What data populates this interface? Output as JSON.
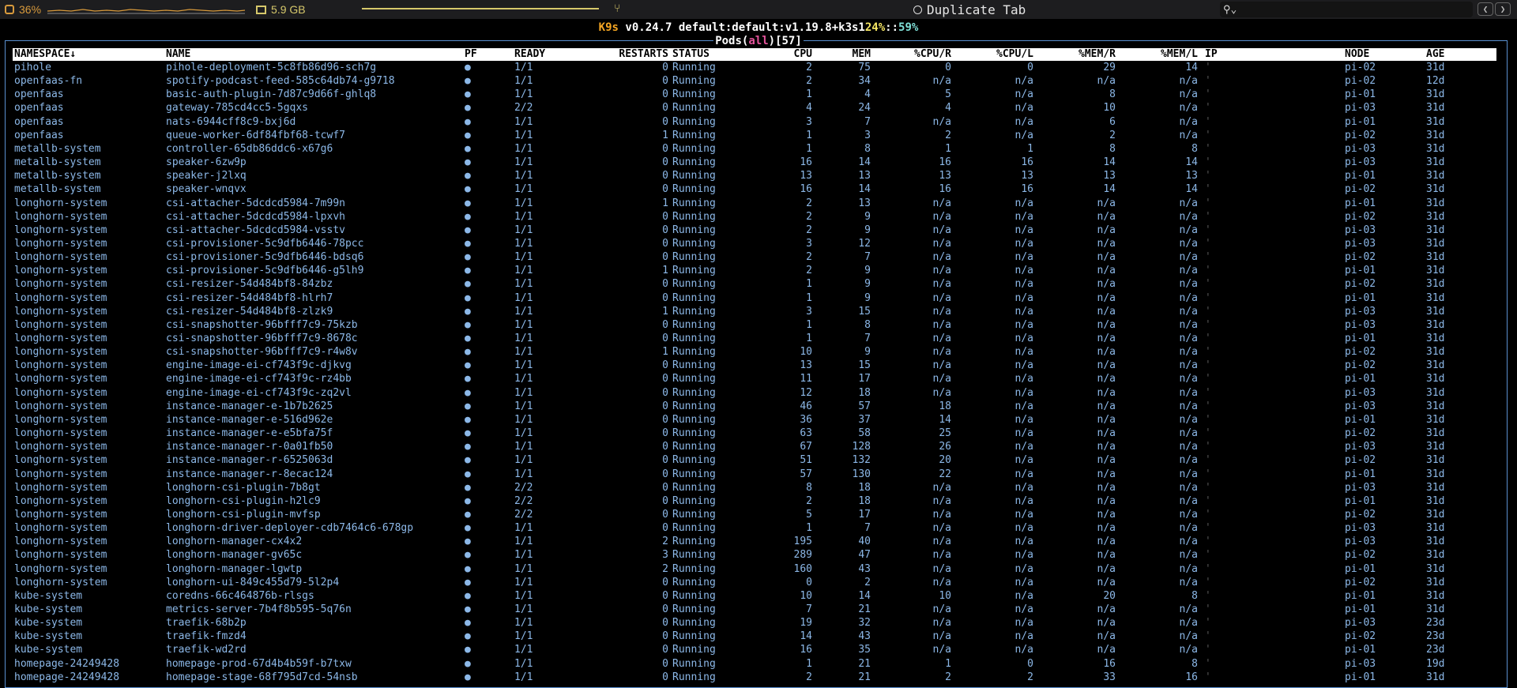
{
  "topbar": {
    "cpu_percent": "36%",
    "memory": "5.9 GB",
    "duplicate_tab": "Duplicate Tab"
  },
  "header": {
    "app": "K9s",
    "version": "v0.24.7",
    "context": "default:default:v1.19.8+k3s1",
    "cpu": "24%",
    "sep": "::",
    "mem": "59%"
  },
  "frame": {
    "resource": "Pods",
    "filter": "all",
    "count": "57"
  },
  "columns": {
    "namespace": "NAMESPACE↓",
    "name": "NAME",
    "pf": "PF",
    "ready": "READY",
    "restarts": "RESTARTS",
    "status": "STATUS",
    "cpu": "CPU",
    "mem": "MEM",
    "cpu_r": "%CPU/R",
    "cpu_l": "%CPU/L",
    "mem_r": "%MEM/R",
    "mem_l": "%MEM/L",
    "ip": "IP",
    "node": "NODE",
    "age": "AGE"
  },
  "rows": [
    [
      "pihole",
      "pihole-deployment-5c8fb86d96-sch7g",
      "●",
      "1/1",
      "0",
      "Running",
      "2",
      "75",
      "0",
      "0",
      "29",
      "14",
      "pi-02",
      "31d"
    ],
    [
      "openfaas-fn",
      "spotify-podcast-feed-585c64db74-g9718",
      "●",
      "1/1",
      "0",
      "Running",
      "2",
      "34",
      "n/a",
      "n/a",
      "n/a",
      "n/a",
      "pi-02",
      "12d"
    ],
    [
      "openfaas",
      "basic-auth-plugin-7d87c9d66f-ghlq8",
      "●",
      "1/1",
      "0",
      "Running",
      "1",
      "4",
      "5",
      "n/a",
      "8",
      "n/a",
      "pi-01",
      "31d"
    ],
    [
      "openfaas",
      "gateway-785cd4cc5-5gqxs",
      "●",
      "2/2",
      "0",
      "Running",
      "4",
      "24",
      "4",
      "n/a",
      "10",
      "n/a",
      "pi-03",
      "31d"
    ],
    [
      "openfaas",
      "nats-6944cff8c9-bxj6d",
      "●",
      "1/1",
      "0",
      "Running",
      "3",
      "7",
      "n/a",
      "n/a",
      "6",
      "n/a",
      "pi-01",
      "31d"
    ],
    [
      "openfaas",
      "queue-worker-6df84fbf68-tcwf7",
      "●",
      "1/1",
      "1",
      "Running",
      "1",
      "3",
      "2",
      "n/a",
      "2",
      "n/a",
      "pi-02",
      "31d"
    ],
    [
      "metallb-system",
      "controller-65db86ddc6-x67g6",
      "●",
      "1/1",
      "0",
      "Running",
      "1",
      "8",
      "1",
      "1",
      "8",
      "8",
      "pi-03",
      "31d"
    ],
    [
      "metallb-system",
      "speaker-6zw9p",
      "●",
      "1/1",
      "0",
      "Running",
      "16",
      "14",
      "16",
      "16",
      "14",
      "14",
      "pi-03",
      "31d"
    ],
    [
      "metallb-system",
      "speaker-j2lxq",
      "●",
      "1/1",
      "0",
      "Running",
      "13",
      "13",
      "13",
      "13",
      "13",
      "13",
      "pi-01",
      "31d"
    ],
    [
      "metallb-system",
      "speaker-wnqvx",
      "●",
      "1/1",
      "0",
      "Running",
      "16",
      "14",
      "16",
      "16",
      "14",
      "14",
      "pi-02",
      "31d"
    ],
    [
      "longhorn-system",
      "csi-attacher-5dcdcd5984-7m99n",
      "●",
      "1/1",
      "1",
      "Running",
      "2",
      "13",
      "n/a",
      "n/a",
      "n/a",
      "n/a",
      "pi-01",
      "31d"
    ],
    [
      "longhorn-system",
      "csi-attacher-5dcdcd5984-lpxvh",
      "●",
      "1/1",
      "0",
      "Running",
      "2",
      "9",
      "n/a",
      "n/a",
      "n/a",
      "n/a",
      "pi-02",
      "31d"
    ],
    [
      "longhorn-system",
      "csi-attacher-5dcdcd5984-vsstv",
      "●",
      "1/1",
      "0",
      "Running",
      "2",
      "9",
      "n/a",
      "n/a",
      "n/a",
      "n/a",
      "pi-03",
      "31d"
    ],
    [
      "longhorn-system",
      "csi-provisioner-5c9dfb6446-78pcc",
      "●",
      "1/1",
      "0",
      "Running",
      "3",
      "12",
      "n/a",
      "n/a",
      "n/a",
      "n/a",
      "pi-03",
      "31d"
    ],
    [
      "longhorn-system",
      "csi-provisioner-5c9dfb6446-bdsq6",
      "●",
      "1/1",
      "0",
      "Running",
      "2",
      "7",
      "n/a",
      "n/a",
      "n/a",
      "n/a",
      "pi-02",
      "31d"
    ],
    [
      "longhorn-system",
      "csi-provisioner-5c9dfb6446-g5lh9",
      "●",
      "1/1",
      "1",
      "Running",
      "2",
      "9",
      "n/a",
      "n/a",
      "n/a",
      "n/a",
      "pi-01",
      "31d"
    ],
    [
      "longhorn-system",
      "csi-resizer-54d484bf8-84zbz",
      "●",
      "1/1",
      "0",
      "Running",
      "1",
      "9",
      "n/a",
      "n/a",
      "n/a",
      "n/a",
      "pi-02",
      "31d"
    ],
    [
      "longhorn-system",
      "csi-resizer-54d484bf8-hlrh7",
      "●",
      "1/1",
      "0",
      "Running",
      "1",
      "9",
      "n/a",
      "n/a",
      "n/a",
      "n/a",
      "pi-01",
      "31d"
    ],
    [
      "longhorn-system",
      "csi-resizer-54d484bf8-zlzk9",
      "●",
      "1/1",
      "1",
      "Running",
      "3",
      "15",
      "n/a",
      "n/a",
      "n/a",
      "n/a",
      "pi-03",
      "31d"
    ],
    [
      "longhorn-system",
      "csi-snapshotter-96bfff7c9-75kzb",
      "●",
      "1/1",
      "0",
      "Running",
      "1",
      "8",
      "n/a",
      "n/a",
      "n/a",
      "n/a",
      "pi-03",
      "31d"
    ],
    [
      "longhorn-system",
      "csi-snapshotter-96bfff7c9-8678c",
      "●",
      "1/1",
      "0",
      "Running",
      "1",
      "7",
      "n/a",
      "n/a",
      "n/a",
      "n/a",
      "pi-01",
      "31d"
    ],
    [
      "longhorn-system",
      "csi-snapshotter-96bfff7c9-r4w8v",
      "●",
      "1/1",
      "1",
      "Running",
      "10",
      "9",
      "n/a",
      "n/a",
      "n/a",
      "n/a",
      "pi-02",
      "31d"
    ],
    [
      "longhorn-system",
      "engine-image-ei-cf743f9c-djkvg",
      "●",
      "1/1",
      "0",
      "Running",
      "13",
      "15",
      "n/a",
      "n/a",
      "n/a",
      "n/a",
      "pi-02",
      "31d"
    ],
    [
      "longhorn-system",
      "engine-image-ei-cf743f9c-rz4bb",
      "●",
      "1/1",
      "0",
      "Running",
      "11",
      "17",
      "n/a",
      "n/a",
      "n/a",
      "n/a",
      "pi-01",
      "31d"
    ],
    [
      "longhorn-system",
      "engine-image-ei-cf743f9c-zq2vl",
      "●",
      "1/1",
      "0",
      "Running",
      "12",
      "18",
      "n/a",
      "n/a",
      "n/a",
      "n/a",
      "pi-03",
      "31d"
    ],
    [
      "longhorn-system",
      "instance-manager-e-1b7b2625",
      "●",
      "1/1",
      "0",
      "Running",
      "46",
      "57",
      "18",
      "n/a",
      "n/a",
      "n/a",
      "pi-03",
      "31d"
    ],
    [
      "longhorn-system",
      "instance-manager-e-516d962e",
      "●",
      "1/1",
      "0",
      "Running",
      "36",
      "37",
      "14",
      "n/a",
      "n/a",
      "n/a",
      "pi-01",
      "31d"
    ],
    [
      "longhorn-system",
      "instance-manager-e-e5bfa75f",
      "●",
      "1/1",
      "0",
      "Running",
      "63",
      "58",
      "25",
      "n/a",
      "n/a",
      "n/a",
      "pi-02",
      "31d"
    ],
    [
      "longhorn-system",
      "instance-manager-r-0a01fb50",
      "●",
      "1/1",
      "0",
      "Running",
      "67",
      "128",
      "26",
      "n/a",
      "n/a",
      "n/a",
      "pi-03",
      "31d"
    ],
    [
      "longhorn-system",
      "instance-manager-r-6525063d",
      "●",
      "1/1",
      "0",
      "Running",
      "51",
      "132",
      "20",
      "n/a",
      "n/a",
      "n/a",
      "pi-02",
      "31d"
    ],
    [
      "longhorn-system",
      "instance-manager-r-8ecac124",
      "●",
      "1/1",
      "0",
      "Running",
      "57",
      "130",
      "22",
      "n/a",
      "n/a",
      "n/a",
      "pi-01",
      "31d"
    ],
    [
      "longhorn-system",
      "longhorn-csi-plugin-7b8gt",
      "●",
      "2/2",
      "0",
      "Running",
      "8",
      "18",
      "n/a",
      "n/a",
      "n/a",
      "n/a",
      "pi-03",
      "31d"
    ],
    [
      "longhorn-system",
      "longhorn-csi-plugin-h2lc9",
      "●",
      "2/2",
      "0",
      "Running",
      "2",
      "18",
      "n/a",
      "n/a",
      "n/a",
      "n/a",
      "pi-01",
      "31d"
    ],
    [
      "longhorn-system",
      "longhorn-csi-plugin-mvfsp",
      "●",
      "2/2",
      "0",
      "Running",
      "5",
      "17",
      "n/a",
      "n/a",
      "n/a",
      "n/a",
      "pi-02",
      "31d"
    ],
    [
      "longhorn-system",
      "longhorn-driver-deployer-cdb7464c6-678gp",
      "●",
      "1/1",
      "0",
      "Running",
      "1",
      "7",
      "n/a",
      "n/a",
      "n/a",
      "n/a",
      "pi-03",
      "31d"
    ],
    [
      "longhorn-system",
      "longhorn-manager-cx4x2",
      "●",
      "1/1",
      "2",
      "Running",
      "195",
      "40",
      "n/a",
      "n/a",
      "n/a",
      "n/a",
      "pi-03",
      "31d"
    ],
    [
      "longhorn-system",
      "longhorn-manager-gv65c",
      "●",
      "1/1",
      "3",
      "Running",
      "289",
      "47",
      "n/a",
      "n/a",
      "n/a",
      "n/a",
      "pi-02",
      "31d"
    ],
    [
      "longhorn-system",
      "longhorn-manager-lgwtp",
      "●",
      "1/1",
      "2",
      "Running",
      "160",
      "43",
      "n/a",
      "n/a",
      "n/a",
      "n/a",
      "pi-01",
      "31d"
    ],
    [
      "longhorn-system",
      "longhorn-ui-849c455d79-5l2p4",
      "●",
      "1/1",
      "0",
      "Running",
      "0",
      "2",
      "n/a",
      "n/a",
      "n/a",
      "n/a",
      "pi-02",
      "31d"
    ],
    [
      "kube-system",
      "coredns-66c464876b-rlsgs",
      "●",
      "1/1",
      "0",
      "Running",
      "10",
      "14",
      "10",
      "n/a",
      "20",
      "8",
      "pi-01",
      "31d"
    ],
    [
      "kube-system",
      "metrics-server-7b4f8b595-5q76n",
      "●",
      "1/1",
      "0",
      "Running",
      "7",
      "21",
      "n/a",
      "n/a",
      "n/a",
      "n/a",
      "pi-01",
      "31d"
    ],
    [
      "kube-system",
      "traefik-68b2p",
      "●",
      "1/1",
      "0",
      "Running",
      "19",
      "32",
      "n/a",
      "n/a",
      "n/a",
      "n/a",
      "pi-03",
      "23d"
    ],
    [
      "kube-system",
      "traefik-fmzd4",
      "●",
      "1/1",
      "0",
      "Running",
      "14",
      "43",
      "n/a",
      "n/a",
      "n/a",
      "n/a",
      "pi-02",
      "23d"
    ],
    [
      "kube-system",
      "traefik-wd2rd",
      "●",
      "1/1",
      "0",
      "Running",
      "16",
      "35",
      "n/a",
      "n/a",
      "n/a",
      "n/a",
      "pi-01",
      "23d"
    ],
    [
      "homepage-24249428",
      "homepage-prod-67d4b4b59f-b7txw",
      "●",
      "1/1",
      "0",
      "Running",
      "1",
      "21",
      "1",
      "0",
      "16",
      "8",
      "pi-03",
      "19d"
    ],
    [
      "homepage-24249428",
      "homepage-stage-68f795d7cd-54nsb",
      "●",
      "1/1",
      "0",
      "Running",
      "2",
      "21",
      "2",
      "2",
      "33",
      "16",
      "pi-01",
      "31d"
    ]
  ]
}
